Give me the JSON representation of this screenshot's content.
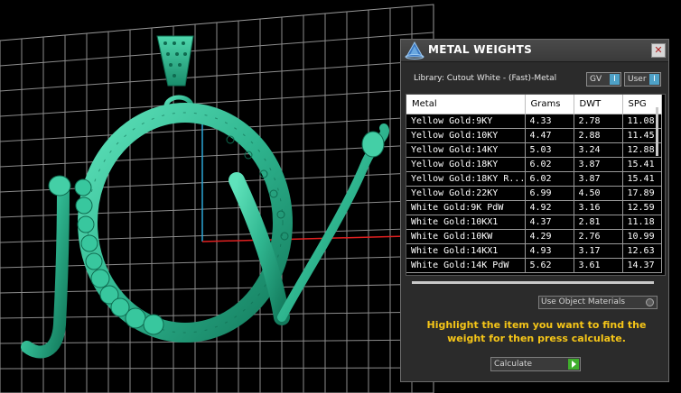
{
  "panel": {
    "title": "METAL WEIGHTS",
    "close_label": "✕",
    "library_label": "Library: Cutout White - (Fast)-Metal",
    "toggles": [
      {
        "label": "GV",
        "indicator": "I"
      },
      {
        "label": "User",
        "indicator": "I"
      }
    ],
    "table": {
      "columns": [
        "Metal",
        "Grams",
        "DWT",
        "SPG"
      ],
      "rows": [
        [
          "Yellow Gold:9KY",
          "4.33",
          "2.78",
          "11.08"
        ],
        [
          "Yellow Gold:10KY",
          "4.47",
          "2.88",
          "11.45"
        ],
        [
          "Yellow Gold:14KY",
          "5.03",
          "3.24",
          "12.88"
        ],
        [
          "Yellow Gold:18KY",
          "6.02",
          "3.87",
          "15.41"
        ],
        [
          "Yellow Gold:18KY R...",
          "6.02",
          "3.87",
          "15.41"
        ],
        [
          "Yellow Gold:22KY",
          "6.99",
          "4.50",
          "17.89"
        ],
        [
          "White Gold:9K PdW",
          "4.92",
          "3.16",
          "12.59"
        ],
        [
          "White Gold:10KX1",
          "4.37",
          "2.81",
          "11.18"
        ],
        [
          "White Gold:10KW",
          "4.29",
          "2.76",
          "10.99"
        ],
        [
          "White Gold:14KX1",
          "4.93",
          "3.17",
          "12.63"
        ],
        [
          "White Gold:14K PdW",
          "5.62",
          "3.61",
          "14.37"
        ]
      ]
    },
    "use_object_materials": "Use Object Materials",
    "instructions": "Highlight the item you want to find the weight for then press calculate.",
    "calculate_label": "Calculate"
  },
  "colors": {
    "viewport_bg": "#000000",
    "grid": "#8c8c8c",
    "axis_x": "#e02020",
    "axis_y": "#2aa6d6",
    "model": "#2fb58f",
    "instructions": "#f5c518"
  }
}
